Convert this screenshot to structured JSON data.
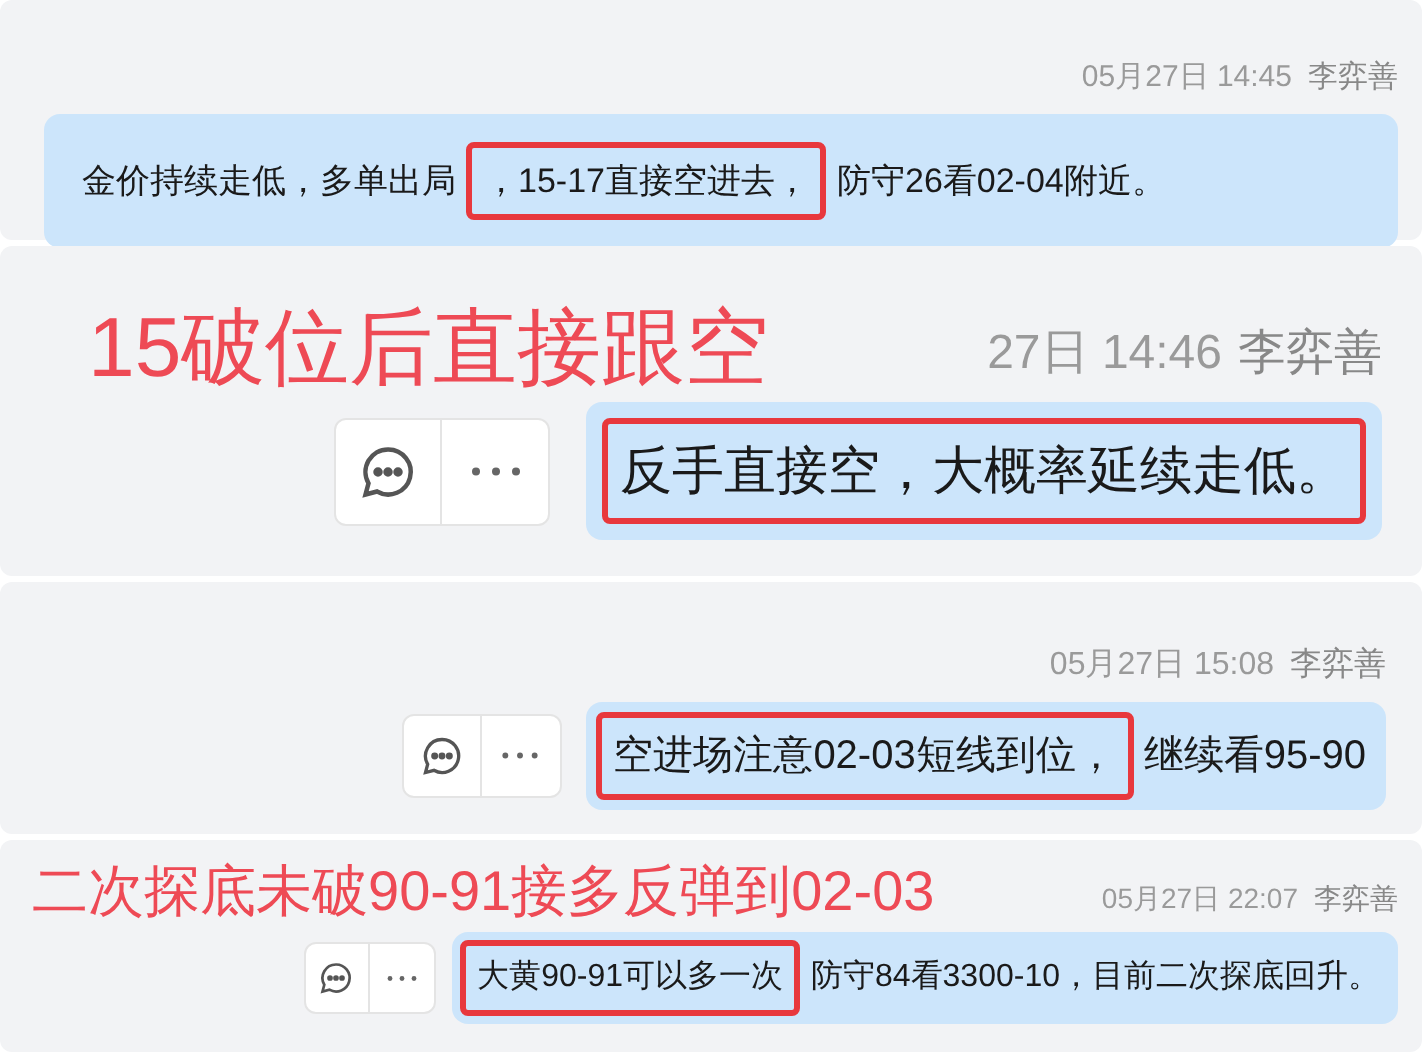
{
  "messages": [
    {
      "time": "05月27日 14:45",
      "sender": "李弈善",
      "show_actions": false,
      "segments": [
        {
          "text": "金价持续走低，多单出局",
          "highlighted": false
        },
        {
          "text": "，15-17直接空进去，",
          "highlighted": true
        },
        {
          "text": "防守26看02-04附近。",
          "highlighted": false
        }
      ]
    },
    {
      "annotation": "15破位后直接跟空",
      "time": "27日 14:46",
      "sender": "李弈善",
      "show_actions": true,
      "segments": [
        {
          "text": "反手直接空，大概率延续走低。",
          "highlighted": true
        }
      ]
    },
    {
      "time": "05月27日 15:08",
      "sender": "李弈善",
      "show_actions": true,
      "segments": [
        {
          "text": "空进场注意02-03短线到位，",
          "highlighted": true
        },
        {
          "text": "继续看95-90",
          "highlighted": false
        }
      ]
    },
    {
      "annotation": "二次探底未破90-91接多反弹到02-03",
      "time": "05月27日 22:07",
      "sender": "李弈善",
      "show_actions": true,
      "segments": [
        {
          "text": "大黄90-91可以多一次",
          "highlighted": true
        },
        {
          "text": "防守84看3300-10，目前二次探底回升。",
          "highlighted": false
        }
      ]
    }
  ]
}
